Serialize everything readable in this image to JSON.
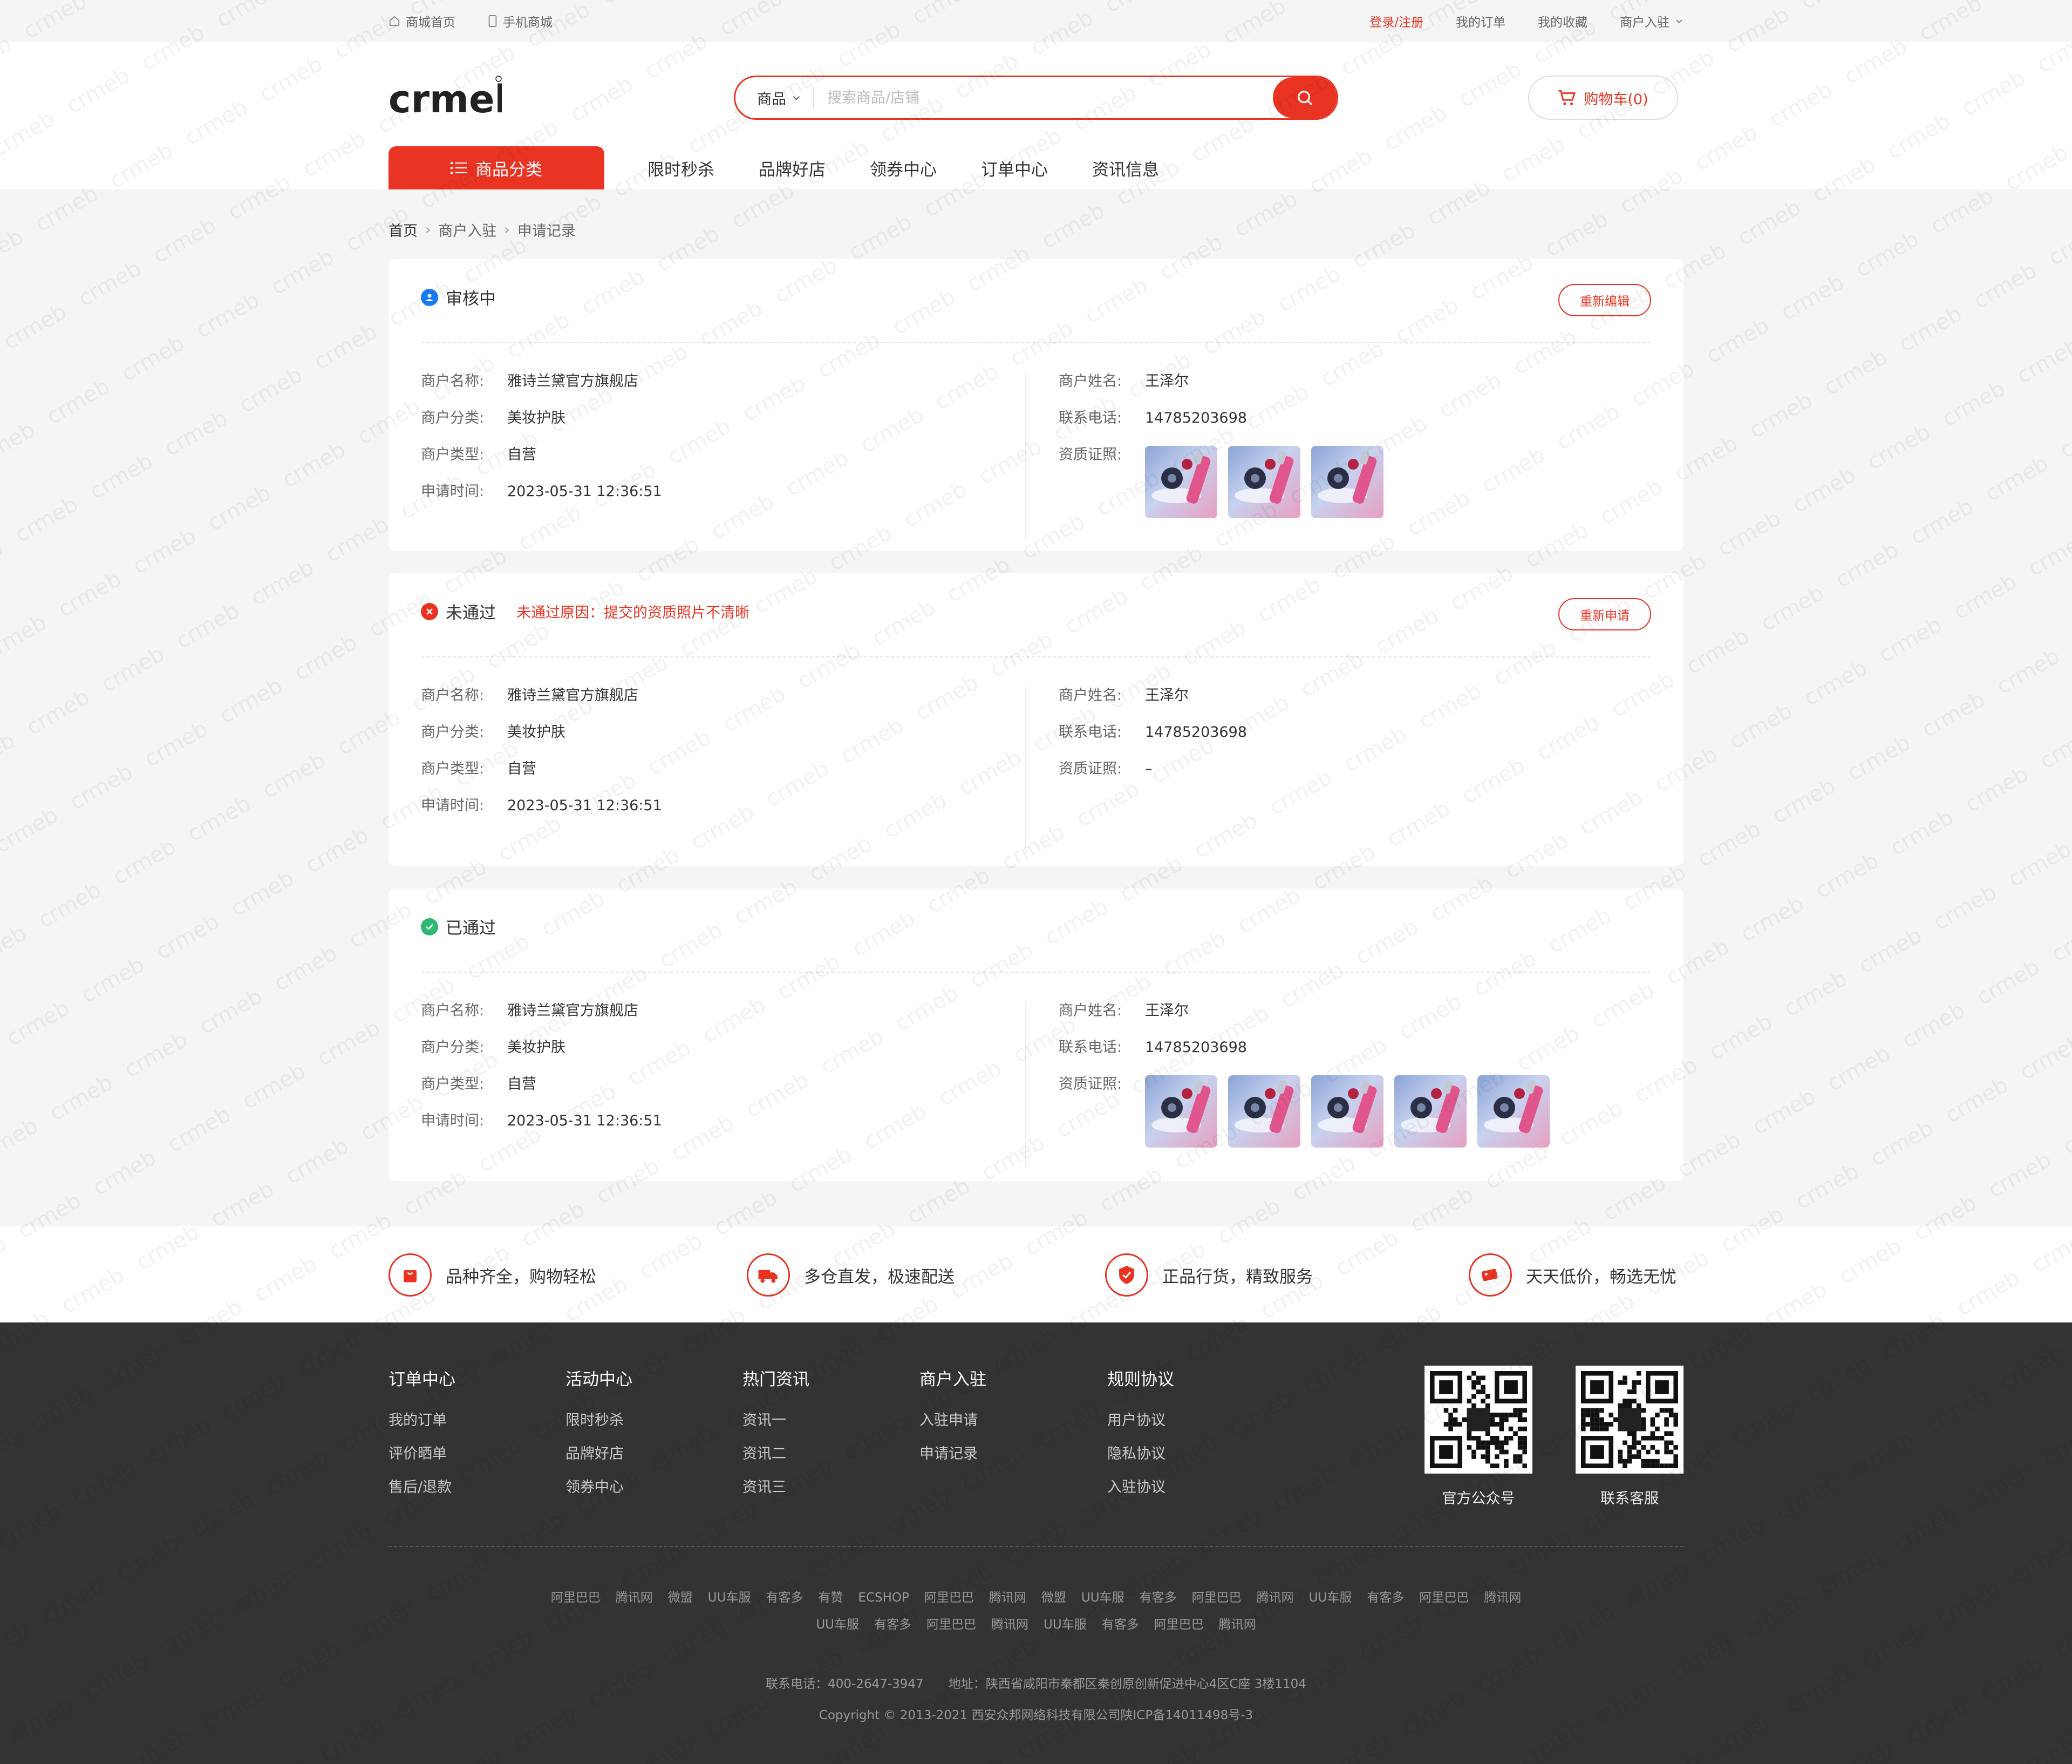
{
  "topbar": {
    "home": "商城首页",
    "mobile": "手机商城",
    "login": "登录/注册",
    "orders": "我的订单",
    "favorites": "我的收藏",
    "merchant": "商户入驻"
  },
  "header": {
    "logo_text": "crmeb",
    "search_type": "商品",
    "search_placeholder": "搜索商品/店铺",
    "cart": "购物车(0)"
  },
  "nav": {
    "category": "商品分类",
    "links": [
      "限时秒杀",
      "品牌好店",
      "领券中心",
      "订单中心",
      "资讯信息"
    ]
  },
  "breadcrumb": [
    "首页",
    "商户入驻",
    "申请记录"
  ],
  "labels": {
    "name": "商户名称:",
    "category": "商户分类:",
    "type": "商户类型:",
    "time": "申请时间:",
    "person": "商户姓名:",
    "phone": "联系电话:",
    "cert": "资质证照:"
  },
  "records": [
    {
      "status": "审核中",
      "reason": "",
      "button": "重新编辑",
      "name": "雅诗兰黛官方旗舰店",
      "category": "美妆护肤",
      "type": "自营",
      "time": "2023-05-31 12:36:51",
      "person": "王泽尔",
      "phone": "14785203698",
      "cert_count": 3,
      "cert_text": ""
    },
    {
      "status": "未通过",
      "reason": "未通过原因：提交的资质照片不清晰",
      "button": "重新申请",
      "name": "雅诗兰黛官方旗舰店",
      "category": "美妆护肤",
      "type": "自营",
      "time": "2023-05-31 12:36:51",
      "person": "王泽尔",
      "phone": "14785203698",
      "cert_count": 0,
      "cert_text": "–"
    },
    {
      "status": "已通过",
      "reason": "",
      "button": "",
      "name": "雅诗兰黛官方旗舰店",
      "category": "美妆护肤",
      "type": "自营",
      "time": "2023-05-31 12:36:51",
      "person": "王泽尔",
      "phone": "14785203698",
      "cert_count": 5,
      "cert_text": ""
    }
  ],
  "features": [
    "品种齐全，购物轻松",
    "多仓直发，极速配送",
    "正品行货，精致服务",
    "天天低价，畅选无忧"
  ],
  "footer": {
    "columns": [
      {
        "title": "订单中心",
        "links": [
          "我的订单",
          "评价晒单",
          "售后/退款"
        ]
      },
      {
        "title": "活动中心",
        "links": [
          "限时秒杀",
          "品牌好店",
          "领券中心"
        ]
      },
      {
        "title": "热门资讯",
        "links": [
          "资讯一",
          "资讯二",
          "资讯三"
        ]
      },
      {
        "title": "商户入驻",
        "links": [
          "入驻申请",
          "申请记录"
        ]
      },
      {
        "title": "规则协议",
        "links": [
          "用户协议",
          "隐私协议",
          "入驻协议"
        ]
      }
    ],
    "qr": [
      "官方公众号",
      "联系客服"
    ],
    "friend_links_1": [
      "阿里巴巴",
      "腾讯网",
      "微盟",
      "UU车服",
      "有客多",
      "有赞",
      "ECSHOP",
      "阿里巴巴",
      "腾讯网",
      "微盟",
      "UU车服",
      "有客多",
      "阿里巴巴",
      "腾讯网",
      "UU车服",
      "有客多",
      "阿里巴巴",
      "腾讯网"
    ],
    "friend_links_2": [
      "UU车服",
      "有客多",
      "阿里巴巴",
      "腾讯网",
      "UU车服",
      "有客多",
      "阿里巴巴",
      "腾讯网"
    ],
    "contact": "联系电话：400-2647-3947　　地址：陕西省咸阳市秦都区秦创原创新促进中心4区C座 3楼1104",
    "copyright": "Copyright © 2013-2021 西安众邦网络科技有限公司陕ICP备14011498号-3"
  },
  "colors": {
    "accent": "#e93323",
    "pending": "#1a7cf5",
    "rejected": "#e93323",
    "approved": "#2eb872"
  }
}
